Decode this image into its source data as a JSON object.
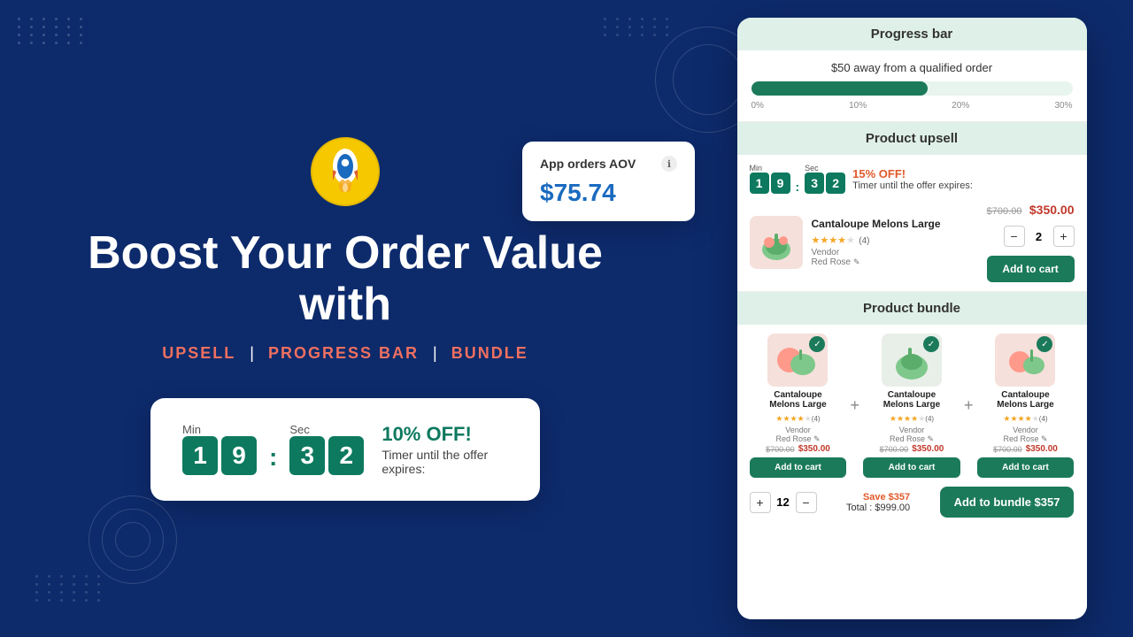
{
  "background": {
    "color": "#0d2a6b"
  },
  "left": {
    "title": "Boost Your Order Value with",
    "subtitle_items": [
      "UPSELL",
      "|",
      "PROGRESS BAR",
      "|",
      "BUNDLE"
    ],
    "timer_card": {
      "min_label": "Min",
      "sec_label": "Sec",
      "digits": [
        "1",
        "9",
        "3",
        "2"
      ],
      "off_label": "10% OFF!",
      "desc": "Timer until the offer expires:"
    }
  },
  "aov_card": {
    "title": "App orders AOV",
    "info_icon": "ℹ",
    "value": "$75.74"
  },
  "right": {
    "progress_bar": {
      "section_header": "Progress bar",
      "label": "$50 away from a qualified order",
      "fill_percent": 55,
      "ticks": [
        "0%",
        "10%",
        "20%",
        "30%"
      ]
    },
    "product_upsell": {
      "section_header": "Product upsell",
      "min_label": "Min",
      "sec_label": "Sec",
      "digits": [
        "1",
        "9",
        "3",
        "2"
      ],
      "off_label": "15% OFF!",
      "desc": "Timer until the offer expires:",
      "product": {
        "name": "Cantaloupe Melons Large",
        "stars": 4,
        "max_stars": 5,
        "review_count": 4,
        "vendor_label": "Vendor",
        "vendor_name": "Red Rose",
        "original_price": "$700.00",
        "sale_price": "$350.00",
        "qty": 2
      },
      "add_to_cart_label": "Add to cart"
    },
    "bundle": {
      "section_header": "Product bundle",
      "products": [
        {
          "name": "Cantaloupe Melons Large",
          "stars": 4,
          "max_stars": 5,
          "review_count": 4,
          "vendor_label": "Vendor",
          "vendor_name": "Red Rose",
          "original_price": "$700.00",
          "sale_price": "$350.00",
          "add_to_cart_label": "Add to cart"
        },
        {
          "name": "Cantaloupe Melons Large",
          "stars": 4,
          "max_stars": 5,
          "review_count": 4,
          "vendor_label": "Vendor",
          "vendor_name": "Red Rose",
          "original_price": "$700.00",
          "sale_price": "$350.00",
          "add_to_cart_label": "Add to cart"
        },
        {
          "name": "Cantaloupe Melons Large",
          "stars": 4,
          "max_stars": 5,
          "review_count": 4,
          "vendor_label": "Vendor",
          "vendor_name": "Red Rose",
          "original_price": "$700.00",
          "sale_price": "$350.00",
          "add_to_cart_label": "Add to cart"
        }
      ],
      "qty": 12,
      "save_label": "Save $357",
      "total_label": "Total : $999.00",
      "add_to_bundle_label": "Add to bundle $357"
    }
  },
  "icons": {
    "check": "✓",
    "plus": "+",
    "minus": "−",
    "info": "ℹ",
    "edit": "✎"
  }
}
